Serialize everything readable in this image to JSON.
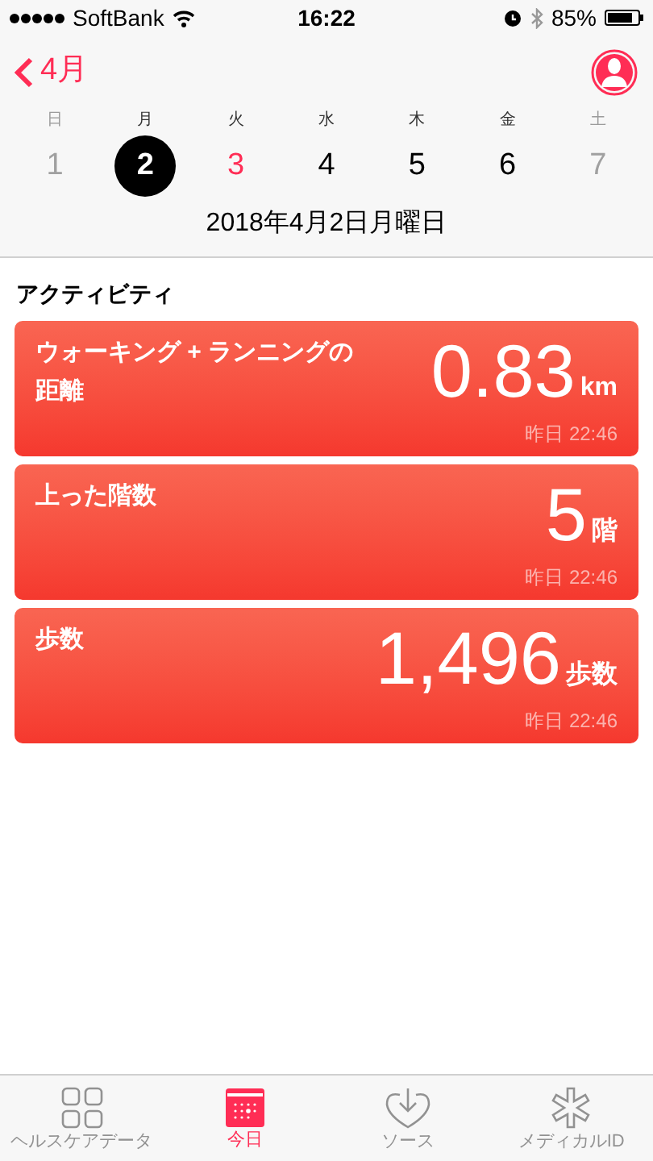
{
  "status_bar": {
    "carrier": "SoftBank",
    "time": "16:22",
    "battery": "85%"
  },
  "nav": {
    "back_label": "4月"
  },
  "week": [
    {
      "weekday": "日",
      "date": "1",
      "kind": "weekend",
      "selected": false,
      "today": false
    },
    {
      "weekday": "月",
      "date": "2",
      "kind": "weekday",
      "selected": true,
      "today": false
    },
    {
      "weekday": "火",
      "date": "3",
      "kind": "weekday",
      "selected": false,
      "today": true
    },
    {
      "weekday": "水",
      "date": "4",
      "kind": "weekday",
      "selected": false,
      "today": false
    },
    {
      "weekday": "木",
      "date": "5",
      "kind": "weekday",
      "selected": false,
      "today": false
    },
    {
      "weekday": "金",
      "date": "6",
      "kind": "weekday",
      "selected": false,
      "today": false
    },
    {
      "weekday": "土",
      "date": "7",
      "kind": "weekend",
      "selected": false,
      "today": false
    }
  ],
  "selected_date": "2018年4月2日月曜日",
  "section_title": "アクティビティ",
  "cards": [
    {
      "title": "ウォーキング + ランニングの距離",
      "value": "0.83",
      "unit": "km",
      "time": "昨日 22:46"
    },
    {
      "title": "上った階数",
      "value": "5",
      "unit": "階",
      "time": "昨日 22:46"
    },
    {
      "title": "歩数",
      "value": "1,496",
      "unit": "歩数",
      "time": "昨日 22:46"
    }
  ],
  "tab_bar": [
    {
      "label": "ヘルスケアデータ",
      "kind": "grid",
      "selected": false
    },
    {
      "label": "今日",
      "kind": "calendar",
      "selected": true
    },
    {
      "label": "ソース",
      "kind": "heart",
      "selected": false
    },
    {
      "label": "メディカルID",
      "kind": "asterisk",
      "selected": false
    }
  ]
}
